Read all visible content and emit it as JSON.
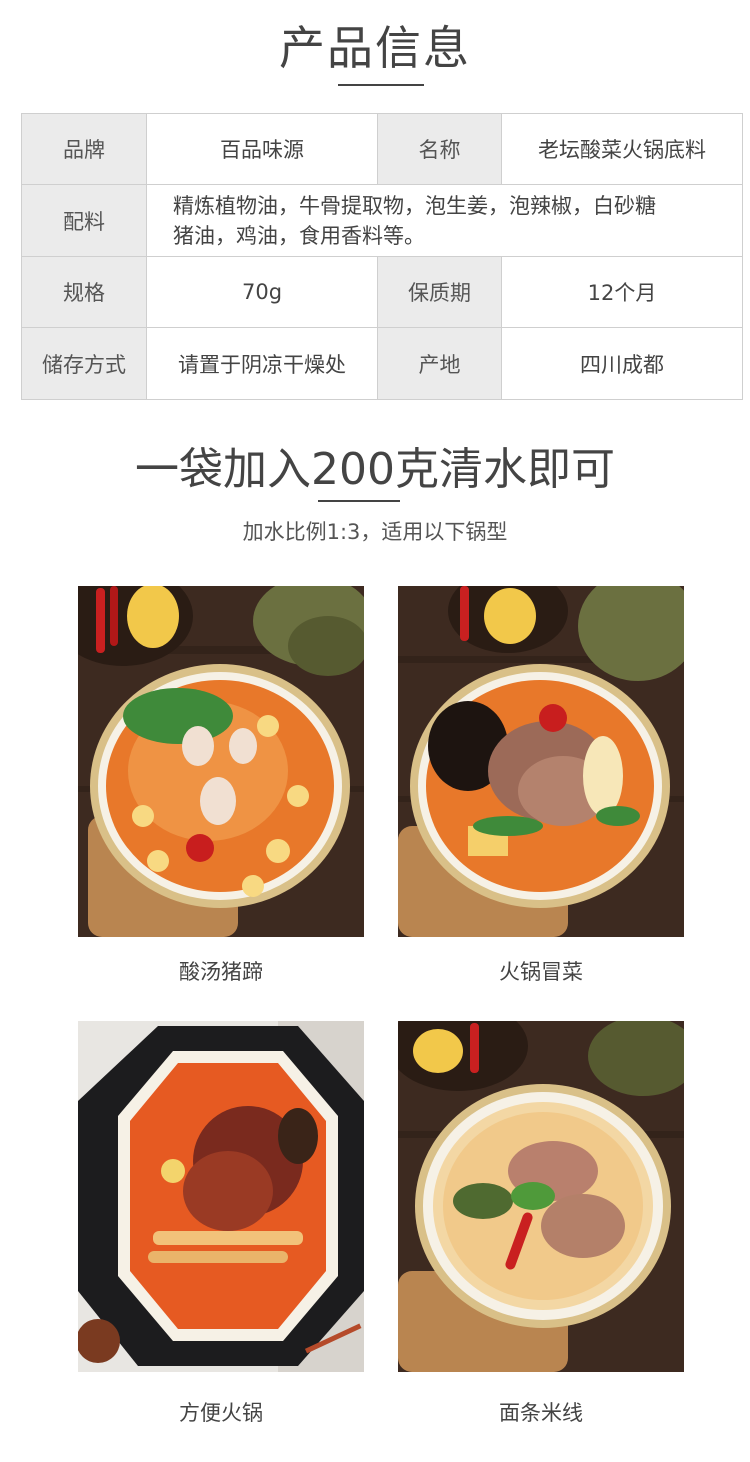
{
  "section_title": "产品信息",
  "spec": {
    "brand_label": "品牌",
    "brand_value": "百品味源",
    "name_label": "名称",
    "name_value": "老坛酸菜火锅底料",
    "ingredients_label": "配料",
    "ingredients_line1": "精炼植物油，牛骨提取物，泡生姜，泡辣椒，白砂糖",
    "ingredients_line2": "猪油，鸡油，食用香料等。",
    "size_label": "规格",
    "size_value": "70g",
    "shelf_label": "保质期",
    "shelf_value": "12个月",
    "storage_label": "储存方式",
    "storage_value": "请置于阴凉干燥处",
    "origin_label": "产地",
    "origin_value": "四川成都"
  },
  "usage": {
    "headline": "一袋加入200克清水即可",
    "subline": "加水比例1:3，适用以下锅型"
  },
  "dishes": [
    {
      "caption": "酸汤猪蹄"
    },
    {
      "caption": "火锅冒菜"
    },
    {
      "caption": "方便火锅"
    },
    {
      "caption": "面条米线"
    }
  ],
  "colors": {
    "label_bg": "#ebebeb",
    "text": "#444444",
    "broth": "#e8782a",
    "wood": "#4a3428"
  }
}
